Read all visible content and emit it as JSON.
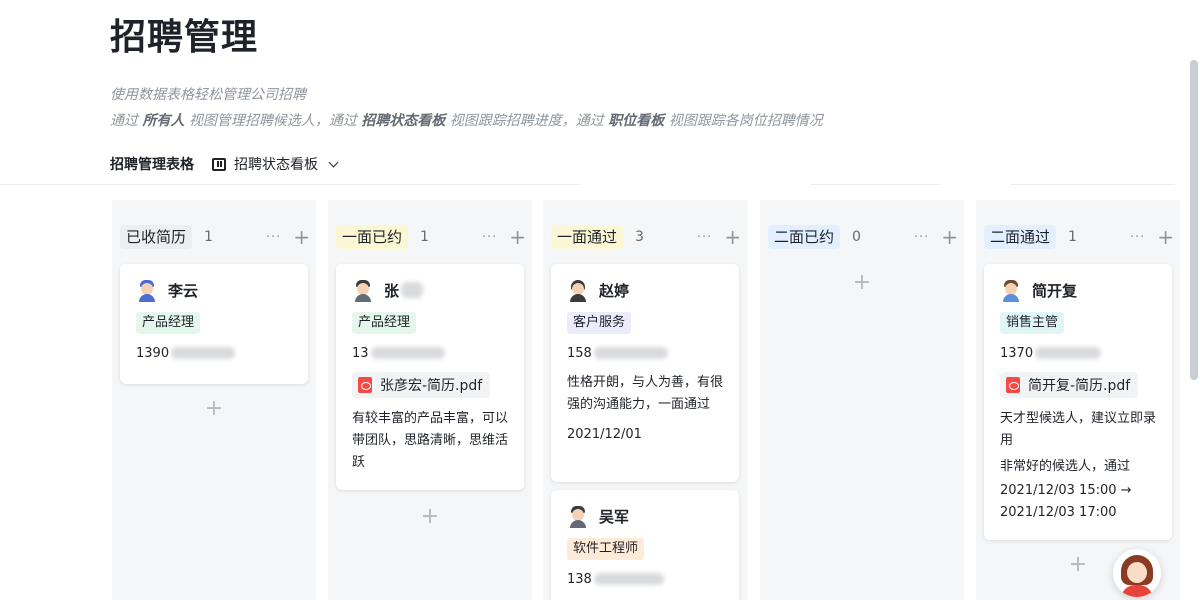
{
  "page": {
    "title": "招聘管理",
    "desc_line1": "使用数据表格轻松管理公司招聘",
    "desc_line2": {
      "p1": "通过 ",
      "b1": "所有人",
      "p2": " 视图管理招聘候选人，通过 ",
      "b2": "招聘状态看板",
      "p3": " 视图跟踪招聘进度，通过 ",
      "b3": "职位看板",
      "p4": " 视图跟踪各岗位招聘情况"
    }
  },
  "views": {
    "table_view": "招聘管理表格",
    "kanban_view": "招聘状态看板",
    "kanban_icon": "kanban-icon"
  },
  "columns": [
    {
      "status": "已收简历",
      "count": "1",
      "tag_color": "#eceef1",
      "cards": [
        {
          "name": "李云",
          "avatar_color": "#4e6cd6",
          "role": "产品经理",
          "role_bg": "#e4f7ed",
          "role_fg": "#1f2329",
          "phone_prefix": "1390"
        }
      ]
    },
    {
      "status": "一面已约",
      "count": "1",
      "tag_color": "#fbf6d3",
      "cards": [
        {
          "name": "张",
          "avatar_color": "#646a73",
          "role": "产品经理",
          "role_bg": "#e4f7ed",
          "role_fg": "#1f2329",
          "phone_prefix": "13",
          "file": "张彦宏-简历.pdf",
          "note": "有较丰富的产品丰富，可以带团队，思路清晰，思维活跃"
        }
      ]
    },
    {
      "status": "一面通过",
      "count": "3",
      "tag_color": "#fbf6d3",
      "cards": [
        {
          "name": "赵婷",
          "avatar_color": "#3b3b3b",
          "role": "客户服务",
          "role_bg": "#ebebfc",
          "role_fg": "#1f2329",
          "phone_prefix": "158",
          "note": "性格开朗，与人为善，有很强的沟通能力，一面通过",
          "date": "2021/12/01"
        },
        {
          "name": "吴军",
          "avatar_color": "#646a73",
          "role": "软件工程师",
          "role_bg": "#fdebd8",
          "role_fg": "#1f2329",
          "phone_prefix": "138"
        }
      ]
    },
    {
      "status": "二面已约",
      "count": "0",
      "tag_color": "#e1efff",
      "cards": []
    },
    {
      "status": "二面通过",
      "count": "1",
      "tag_color": "#e1efff",
      "cards": [
        {
          "name": "简开复",
          "avatar_color": "#5b8fd9",
          "role": "销售主管",
          "role_bg": "#e0f5f5",
          "role_fg": "#1f2329",
          "phone_prefix": "1370",
          "file": "简开复-简历.pdf",
          "note": "天才型候选人，建议立即录用",
          "note2": "非常好的候选人，通过",
          "date": "2021/12/03 15:00 → 2021/12/03 17:00"
        }
      ]
    }
  ],
  "icons": {
    "more": "more-icon",
    "add": "plus-icon",
    "file": "pdf-icon",
    "assistant": "assistant-avatar-icon"
  },
  "glyphs": {
    "more": "···",
    "plus": "+"
  }
}
